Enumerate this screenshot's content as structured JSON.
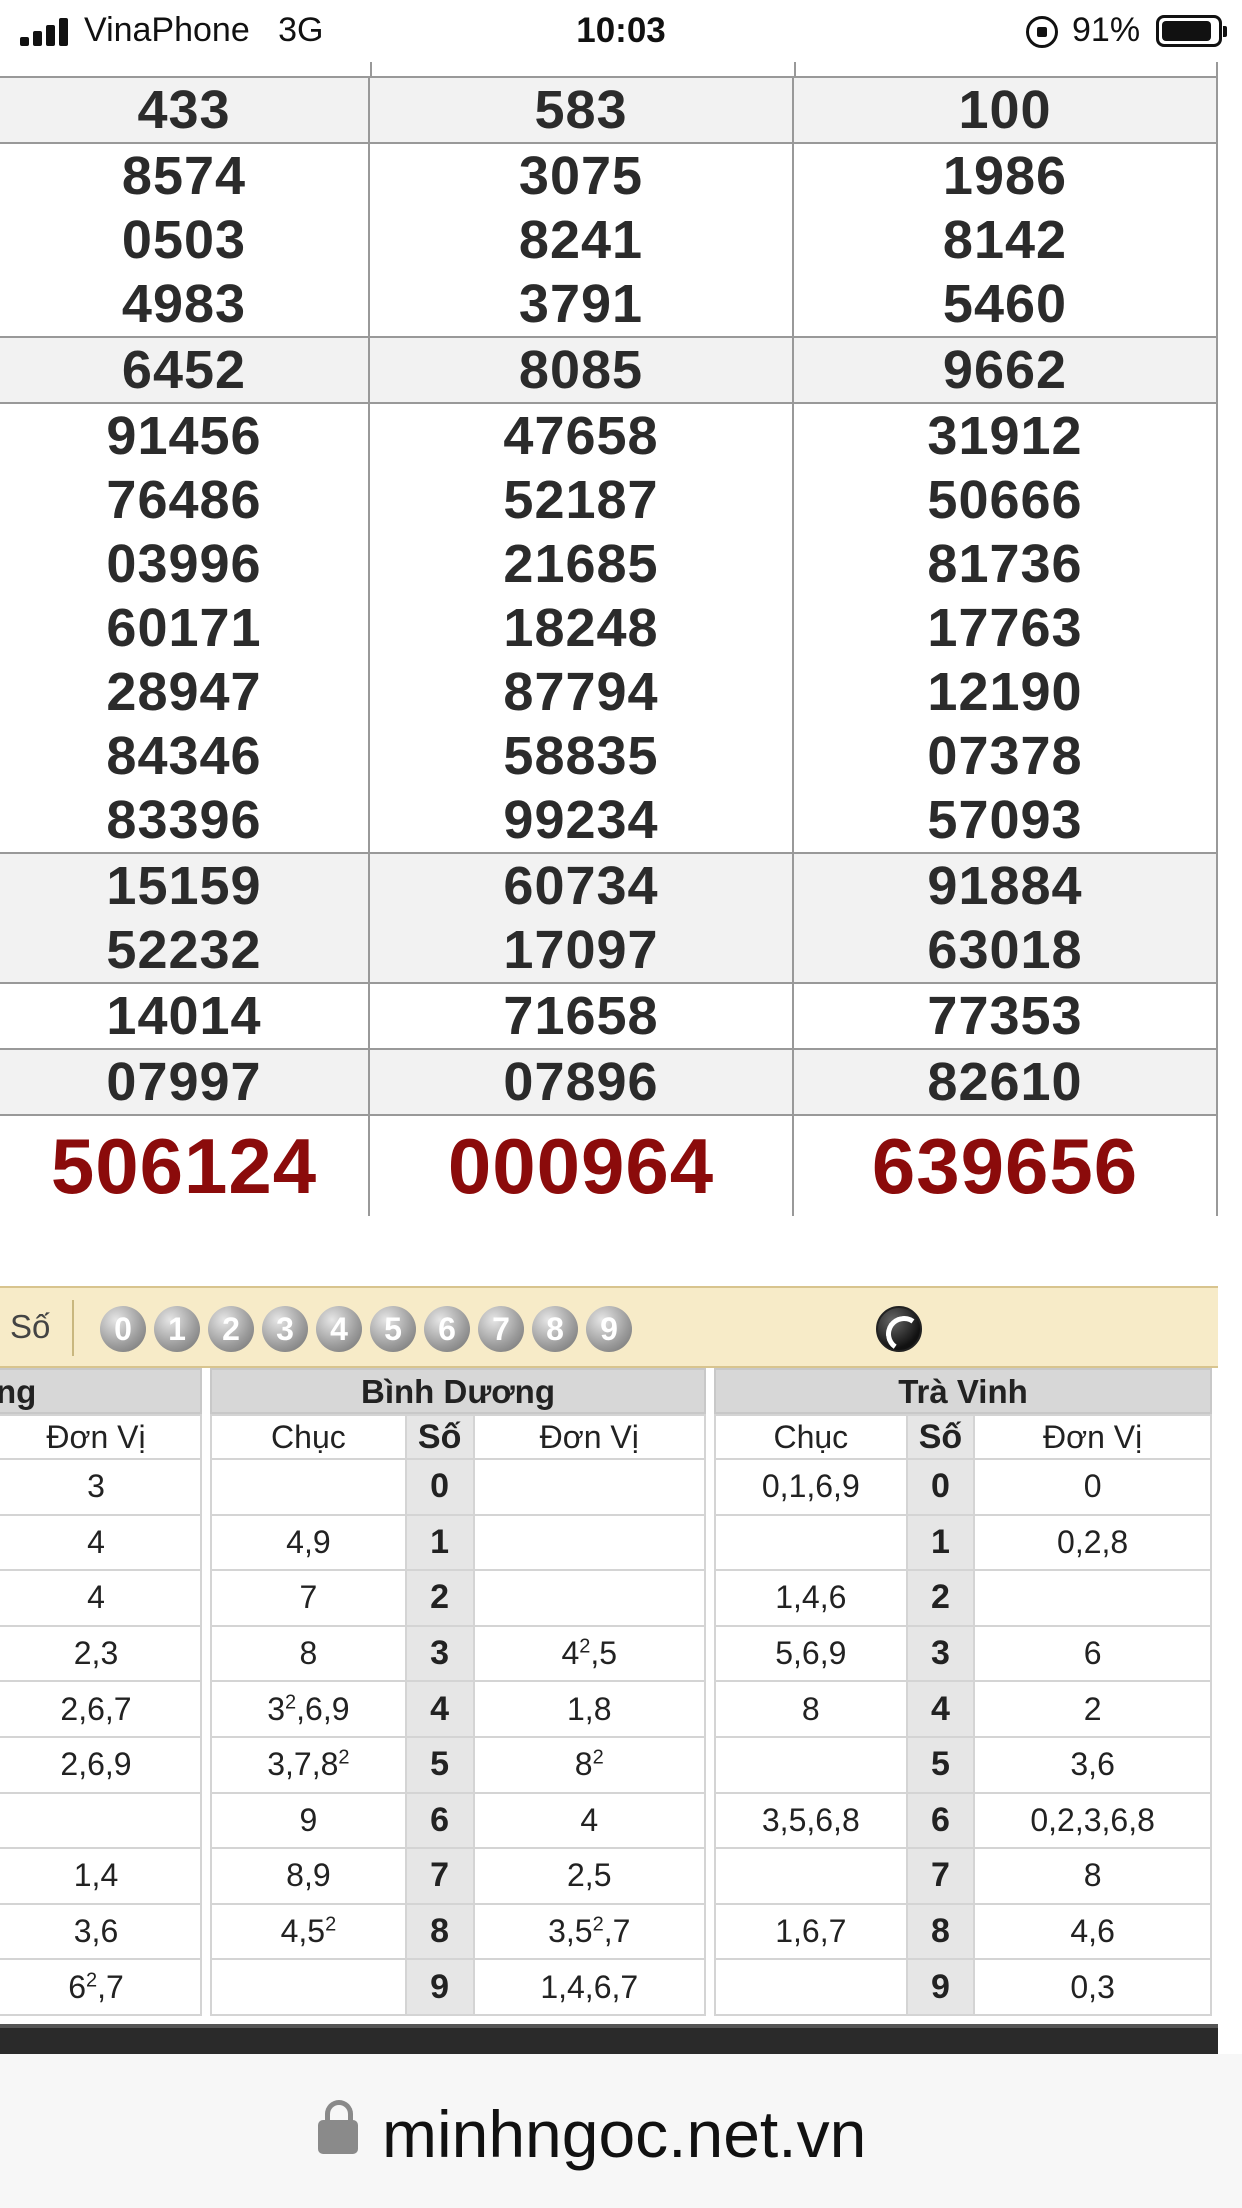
{
  "status_bar": {
    "carrier": "VinaPhone",
    "network": "3G",
    "time": "10:03",
    "battery_percent": "91%",
    "battery_level": 0.91
  },
  "results": {
    "rows": [
      {
        "style": "alt",
        "cells": [
          [
            "433"
          ],
          [
            "583"
          ],
          [
            "100"
          ]
        ]
      },
      {
        "style": "plain",
        "cells": [
          [
            "8574",
            "0503",
            "4983"
          ],
          [
            "3075",
            "8241",
            "3791"
          ],
          [
            "1986",
            "8142",
            "5460"
          ]
        ]
      },
      {
        "style": "alt",
        "cells": [
          [
            "6452"
          ],
          [
            "8085"
          ],
          [
            "9662"
          ]
        ]
      },
      {
        "style": "plain",
        "cells": [
          [
            "91456",
            "76486",
            "03996",
            "60171",
            "28947",
            "84346",
            "83396"
          ],
          [
            "47658",
            "52187",
            "21685",
            "18248",
            "87794",
            "58835",
            "99234"
          ],
          [
            "31912",
            "50666",
            "81736",
            "17763",
            "12190",
            "07378",
            "57093"
          ]
        ]
      },
      {
        "style": "alt",
        "cells": [
          [
            "15159",
            "52232"
          ],
          [
            "60734",
            "17097"
          ],
          [
            "91884",
            "63018"
          ]
        ]
      },
      {
        "style": "plain",
        "cells": [
          [
            "14014"
          ],
          [
            "71658"
          ],
          [
            "77353"
          ]
        ]
      },
      {
        "style": "alt",
        "cells": [
          [
            "07997"
          ],
          [
            "07896"
          ],
          [
            "82610"
          ]
        ]
      },
      {
        "style": "special",
        "cells": [
          [
            "506124"
          ],
          [
            "000964"
          ],
          [
            "639656"
          ]
        ]
      }
    ]
  },
  "filter_bar": {
    "label": "Số",
    "digits": [
      "0",
      "1",
      "2",
      "3",
      "4",
      "5",
      "6",
      "7",
      "8",
      "9"
    ],
    "extra_icon": "yin-yang-icon"
  },
  "loto_tables": {
    "left": {
      "title": "ng",
      "col_donvi": "Đơn Vị",
      "values": [
        "3",
        "4",
        "4",
        "2,3",
        "2,6,7",
        "2,6,9",
        "",
        "1,4",
        "3,6",
        "6^2,7"
      ]
    },
    "binh_duong": {
      "title": "Bình Dương",
      "col_chuc": "Chục",
      "col_so": "Số",
      "col_donvi": "Đơn Vị",
      "rows": [
        {
          "chuc": "",
          "so": "0",
          "donvi": ""
        },
        {
          "chuc": "4,9",
          "so": "1",
          "donvi": ""
        },
        {
          "chuc": "7",
          "so": "2",
          "donvi": ""
        },
        {
          "chuc": "8",
          "so": "3",
          "donvi": "4^2,5"
        },
        {
          "chuc": "3^2,6,9",
          "so": "4",
          "donvi": "1,8"
        },
        {
          "chuc": "3,7,8^2",
          "so": "5",
          "donvi": "8^2"
        },
        {
          "chuc": "9",
          "so": "6",
          "donvi": "4"
        },
        {
          "chuc": "8,9",
          "so": "7",
          "donvi": "2,5"
        },
        {
          "chuc": "4,5^2",
          "so": "8",
          "donvi": "3,5^2,7"
        },
        {
          "chuc": "",
          "so": "9",
          "donvi": "1,4,6,7"
        }
      ]
    },
    "tra_vinh": {
      "title": "Trà Vinh",
      "col_chuc": "Chục",
      "col_so": "Số",
      "col_donvi": "Đơn Vị",
      "rows": [
        {
          "chuc": "0,1,6,9",
          "so": "0",
          "donvi": "0"
        },
        {
          "chuc": "",
          "so": "1",
          "donvi": "0,2,8"
        },
        {
          "chuc": "1,4,6",
          "so": "2",
          "donvi": ""
        },
        {
          "chuc": "5,6,9",
          "so": "3",
          "donvi": "6"
        },
        {
          "chuc": "8",
          "so": "4",
          "donvi": "2"
        },
        {
          "chuc": "",
          "so": "5",
          "donvi": "3,6"
        },
        {
          "chuc": "3,5,6,8",
          "so": "6",
          "donvi": "0,2,3,6,8"
        },
        {
          "chuc": "",
          "so": "7",
          "donvi": "8"
        },
        {
          "chuc": "1,6,7",
          "so": "8",
          "donvi": "4,6"
        },
        {
          "chuc": "",
          "so": "9",
          "donvi": "0,3"
        }
      ]
    }
  },
  "url_bar": {
    "url": "minhngoc.net.vn",
    "icon": "padlock-icon"
  },
  "colors": {
    "special_prize": "#8b0b0b",
    "filter_bar_bg": "#f7ebc8",
    "grid_line": "#999999"
  }
}
